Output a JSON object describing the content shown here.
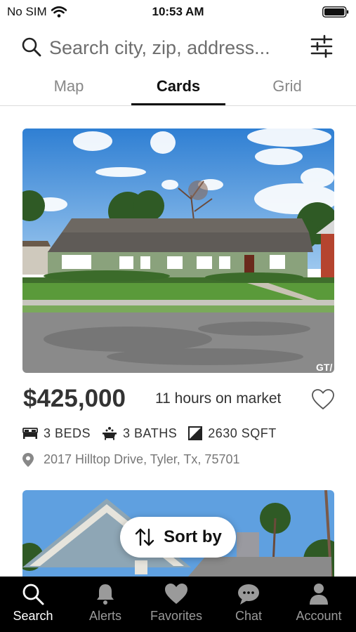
{
  "status_bar": {
    "carrier": "No SIM",
    "time": "10:53 AM"
  },
  "search": {
    "placeholder": "Search city, zip, address..."
  },
  "view_tabs": [
    {
      "label": "Map",
      "active": false
    },
    {
      "label": "Cards",
      "active": true
    },
    {
      "label": "Grid",
      "active": false
    }
  ],
  "listing": {
    "price": "$425,000",
    "time_on_market": "11 hours on market",
    "beds": "3 BEDS",
    "baths": "3 BATHS",
    "sqft": "2630 SQFT",
    "address": "2017 Hilltop Drive, Tyler, Tx, 75701",
    "photo_watermark": "GT/"
  },
  "sort_button": {
    "label": "Sort by"
  },
  "tab_bar": [
    {
      "label": "Search",
      "icon": "search-icon",
      "active": true
    },
    {
      "label": "Alerts",
      "icon": "bell-icon",
      "active": false
    },
    {
      "label": "Favorites",
      "icon": "heart-icon",
      "active": false
    },
    {
      "label": "Chat",
      "icon": "chat-icon",
      "active": false
    },
    {
      "label": "Account",
      "icon": "person-icon",
      "active": false
    }
  ],
  "colors": {
    "tab_bar_bg": "#000000",
    "active_tab": "#ffffff",
    "inactive_tab": "#9a9a9a",
    "sky": "#4a8fd6",
    "lawn": "#5a9a3a",
    "house_siding": "#8aa27c"
  }
}
